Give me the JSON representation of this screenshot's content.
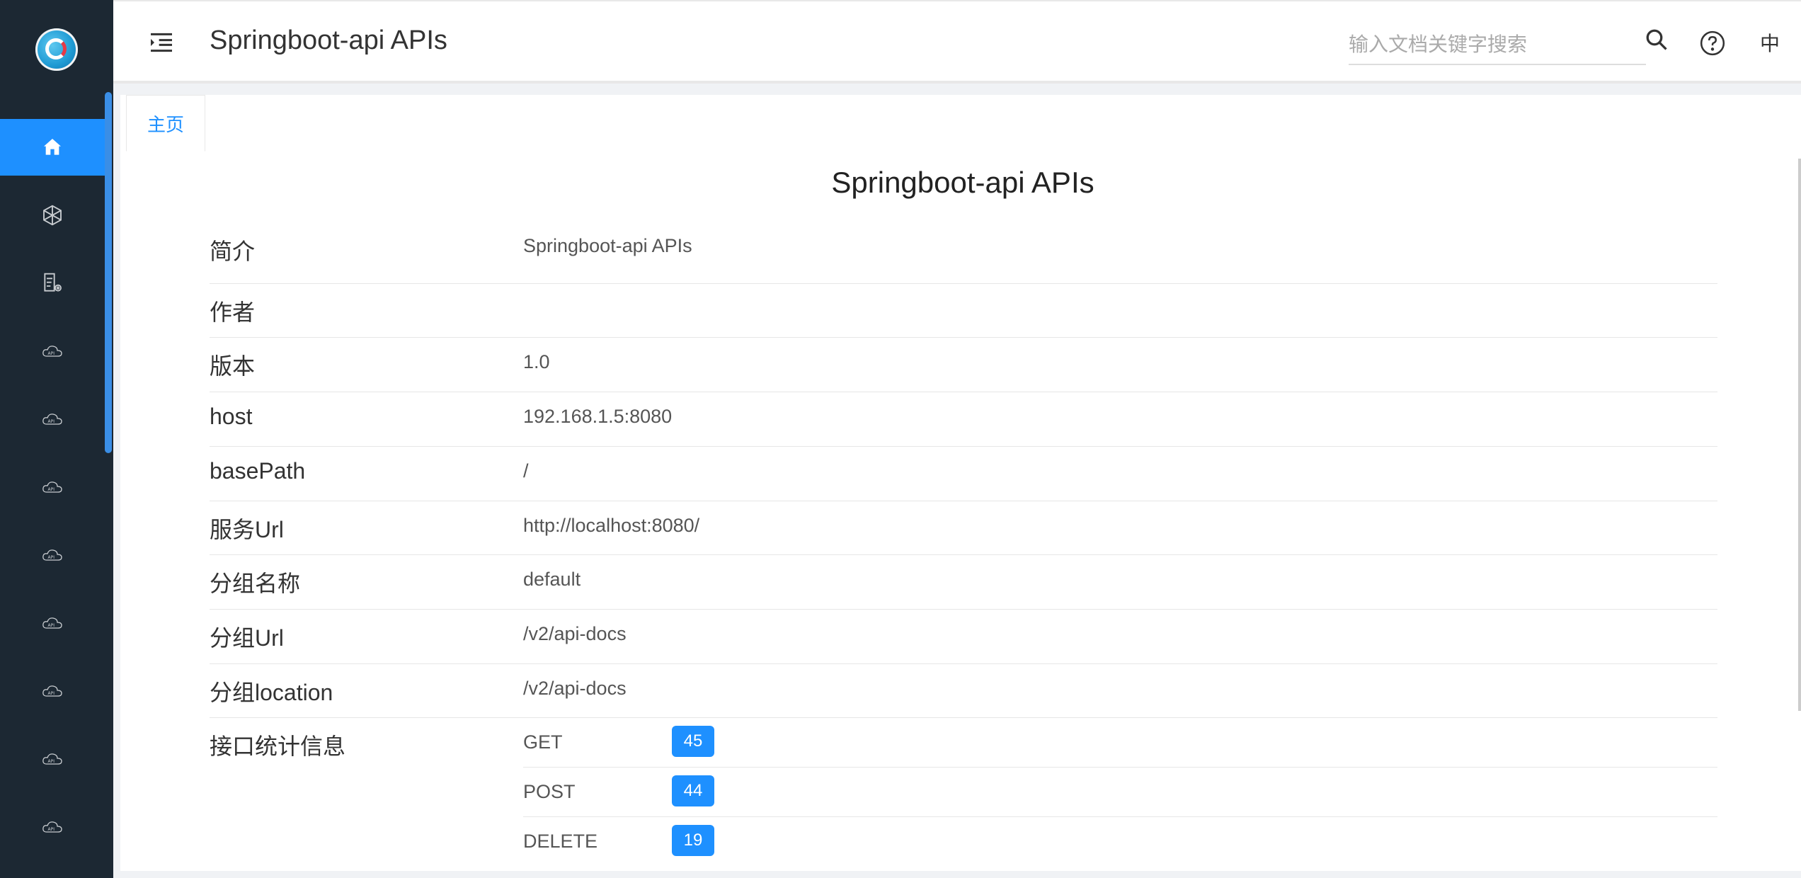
{
  "header": {
    "title": "Springboot-api APIs",
    "search_placeholder": "输入文档关键字搜索",
    "lang_label": "中"
  },
  "sidebar": {
    "logo_icon": "knife4j-logo-icon",
    "items": [
      {
        "icon": "home-icon",
        "active": true
      },
      {
        "icon": "cube-network-icon"
      },
      {
        "icon": "document-settings-icon"
      },
      {
        "icon": "cloud-api-icon",
        "text": "API"
      },
      {
        "icon": "cloud-api-icon",
        "text": "API"
      },
      {
        "icon": "cloud-api-icon",
        "text": "API"
      },
      {
        "icon": "cloud-api-icon",
        "text": "API"
      },
      {
        "icon": "cloud-api-icon",
        "text": "API"
      },
      {
        "icon": "cloud-api-icon",
        "text": "API"
      },
      {
        "icon": "cloud-api-icon",
        "text": "API"
      },
      {
        "icon": "cloud-api-icon",
        "text": "API"
      }
    ]
  },
  "tabs": [
    {
      "label": "主页",
      "active": true
    }
  ],
  "doc": {
    "title": "Springboot-api APIs",
    "rows": [
      {
        "label": "简介",
        "value": "Springboot-api APIs"
      },
      {
        "label": "作者",
        "value": ""
      },
      {
        "label": "版本",
        "value": "1.0"
      },
      {
        "label": "host",
        "value": "192.168.1.5:8080"
      },
      {
        "label": "basePath",
        "value": "/"
      },
      {
        "label": "服务Url",
        "value": "http://localhost:8080/"
      },
      {
        "label": "分组名称",
        "value": "default"
      },
      {
        "label": "分组Url",
        "value": "/v2/api-docs"
      },
      {
        "label": "分组location",
        "value": "/v2/api-docs"
      }
    ],
    "stats_label": "接口统计信息",
    "stats": [
      {
        "method": "GET",
        "count": "45"
      },
      {
        "method": "POST",
        "count": "44"
      },
      {
        "method": "DELETE",
        "count": "19"
      }
    ]
  },
  "colors": {
    "accent": "#1e90ff",
    "sidebar_bg": "#1c2833"
  }
}
